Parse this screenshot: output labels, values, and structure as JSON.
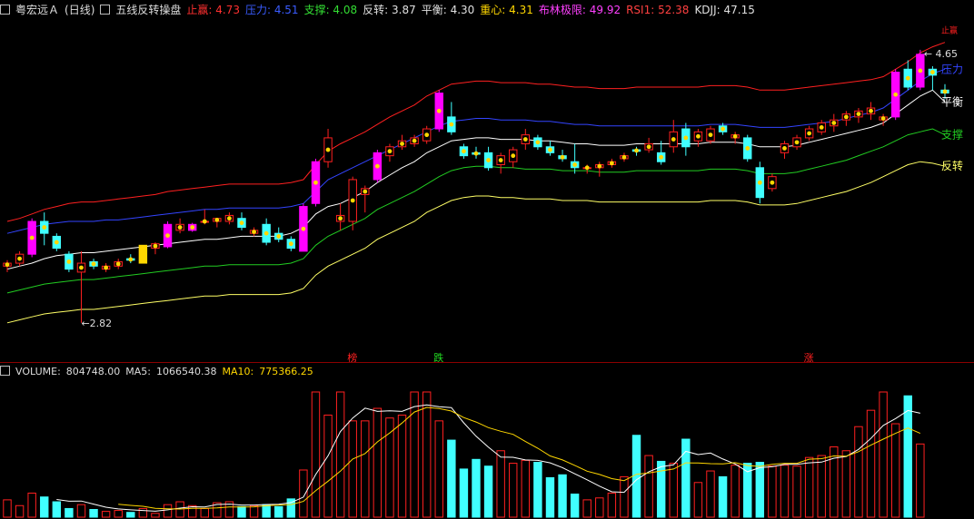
{
  "header": {
    "stock": "粤宏远Ａ",
    "period": "(日线)",
    "indicator": "五线反转操盘",
    "items": [
      {
        "label": "止赢:",
        "value": "4.73",
        "color": "#ff3030"
      },
      {
        "label": "压力:",
        "value": "4.51",
        "color": "#3a5cff"
      },
      {
        "label": "支撑:",
        "value": "4.08",
        "color": "#33dd33"
      },
      {
        "label": "反转:",
        "value": "3.87",
        "color": "#e0e0e0"
      },
      {
        "label": "平衡:",
        "value": "4.30",
        "color": "#e0e0e0"
      },
      {
        "label": "重心:",
        "value": "4.31",
        "color": "#ffd700"
      },
      {
        "label": "布林极限:",
        "value": "49.92",
        "color": "#ff40ff"
      },
      {
        "label": "RSI1:",
        "value": "52.38",
        "color": "#ff4040"
      },
      {
        "label": "KDJJ:",
        "value": "47.15",
        "color": "#e0e0e0"
      }
    ]
  },
  "volume_header": {
    "label": "VOLUME:",
    "value": "804748.00",
    "ma5_label": "MA5:",
    "ma5_value": "1066540.38",
    "ma10_label": "MA10:",
    "ma10_value": "775366.25"
  },
  "colors": {
    "up": "#ff2020",
    "down": "#40ffff",
    "magenta": "#ff00ff",
    "yellow": "#ffd700",
    "stop": "#ff2020",
    "press": "#3344ff",
    "support": "#22cc22",
    "reverse": "#ffff66",
    "balance": "#ffffff"
  },
  "chart_data": [
    {
      "type": "candlestick",
      "price_range": [
        2.6,
        4.85
      ],
      "annotations": {
        "high_label": "4.65",
        "low_label": "2.82",
        "markers": [
          "榜",
          "跌",
          "涨"
        ]
      },
      "line_labels": [
        "止赢",
        "压力",
        "平衡",
        "支撑",
        "反转"
      ],
      "candles": [
        {
          "o": 3.2,
          "h": 3.24,
          "l": 3.16,
          "c": 3.22
        },
        {
          "o": 3.22,
          "h": 3.3,
          "l": 3.2,
          "c": 3.28
        },
        {
          "o": 3.28,
          "h": 3.52,
          "l": 3.26,
          "c": 3.5,
          "m": 1
        },
        {
          "o": 3.5,
          "h": 3.56,
          "l": 3.34,
          "c": 3.42
        },
        {
          "o": 3.4,
          "h": 3.42,
          "l": 3.3,
          "c": 3.32
        },
        {
          "o": 3.28,
          "h": 3.3,
          "l": 3.16,
          "c": 3.18
        },
        {
          "o": 3.16,
          "h": 3.3,
          "l": 2.82,
          "c": 3.22
        },
        {
          "o": 3.23,
          "h": 3.25,
          "l": 3.18,
          "c": 3.2
        },
        {
          "o": 3.18,
          "h": 3.22,
          "l": 3.16,
          "c": 3.2
        },
        {
          "o": 3.2,
          "h": 3.25,
          "l": 3.18,
          "c": 3.23
        },
        {
          "o": 3.25,
          "h": 3.28,
          "l": 3.22,
          "c": 3.24
        },
        {
          "o": 3.22,
          "h": 3.34,
          "l": 3.22,
          "c": 3.34,
          "y": 1
        },
        {
          "o": 3.32,
          "h": 3.36,
          "l": 3.28,
          "c": 3.35
        },
        {
          "o": 3.33,
          "h": 3.5,
          "l": 3.32,
          "c": 3.48,
          "m": 1
        },
        {
          "o": 3.44,
          "h": 3.52,
          "l": 3.42,
          "c": 3.48
        },
        {
          "o": 3.44,
          "h": 3.49,
          "l": 3.43,
          "c": 3.48,
          "m": 1
        },
        {
          "o": 3.5,
          "h": 3.58,
          "l": 3.48,
          "c": 3.5
        },
        {
          "o": 3.5,
          "h": 3.52,
          "l": 3.46,
          "c": 3.52
        },
        {
          "o": 3.5,
          "h": 3.56,
          "l": 3.48,
          "c": 3.54
        },
        {
          "o": 3.52,
          "h": 3.56,
          "l": 3.44,
          "c": 3.46
        },
        {
          "o": 3.42,
          "h": 3.46,
          "l": 3.4,
          "c": 3.44
        },
        {
          "o": 3.48,
          "h": 3.52,
          "l": 3.34,
          "c": 3.36
        },
        {
          "o": 3.42,
          "h": 3.46,
          "l": 3.36,
          "c": 3.38
        },
        {
          "o": 3.38,
          "h": 3.4,
          "l": 3.3,
          "c": 3.32
        },
        {
          "o": 3.3,
          "h": 3.62,
          "l": 3.3,
          "c": 3.6,
          "m": 1
        },
        {
          "o": 3.62,
          "h": 3.92,
          "l": 3.6,
          "c": 3.9,
          "m": 1
        },
        {
          "o": 3.9,
          "h": 4.12,
          "l": 3.86,
          "c": 4.06
        },
        {
          "o": 3.5,
          "h": 3.62,
          "l": 3.44,
          "c": 3.54
        },
        {
          "o": 3.5,
          "h": 3.8,
          "l": 3.44,
          "c": 3.78
        },
        {
          "o": 3.68,
          "h": 3.74,
          "l": 3.56,
          "c": 3.72
        },
        {
          "o": 3.78,
          "h": 3.98,
          "l": 3.76,
          "c": 3.96,
          "m": 1
        },
        {
          "o": 3.94,
          "h": 4.02,
          "l": 3.9,
          "c": 4.0
        },
        {
          "o": 4.0,
          "h": 4.08,
          "l": 3.98,
          "c": 4.04
        },
        {
          "o": 4.02,
          "h": 4.08,
          "l": 4.0,
          "c": 4.06
        },
        {
          "o": 4.04,
          "h": 4.14,
          "l": 4.02,
          "c": 4.12
        },
        {
          "o": 4.12,
          "h": 4.38,
          "l": 4.1,
          "c": 4.36,
          "m": 1
        },
        {
          "o": 4.2,
          "h": 4.3,
          "l": 4.08,
          "c": 4.1
        },
        {
          "o": 4.0,
          "h": 4.02,
          "l": 3.92,
          "c": 3.94
        },
        {
          "o": 3.96,
          "h": 4.0,
          "l": 3.92,
          "c": 3.95
        },
        {
          "o": 3.96,
          "h": 4.0,
          "l": 3.84,
          "c": 3.86
        },
        {
          "o": 3.88,
          "h": 3.96,
          "l": 3.82,
          "c": 3.94
        },
        {
          "o": 3.9,
          "h": 4.0,
          "l": 3.86,
          "c": 3.98
        },
        {
          "o": 4.02,
          "h": 4.12,
          "l": 3.98,
          "c": 4.08
        },
        {
          "o": 4.06,
          "h": 4.08,
          "l": 3.98,
          "c": 4.0
        },
        {
          "o": 4.0,
          "h": 4.04,
          "l": 3.94,
          "c": 3.96
        },
        {
          "o": 3.94,
          "h": 3.98,
          "l": 3.9,
          "c": 3.92
        },
        {
          "o": 3.9,
          "h": 4.02,
          "l": 3.82,
          "c": 3.86
        },
        {
          "o": 3.86,
          "h": 3.88,
          "l": 3.82,
          "c": 3.86
        },
        {
          "o": 3.86,
          "h": 3.9,
          "l": 3.8,
          "c": 3.88
        },
        {
          "o": 3.88,
          "h": 3.92,
          "l": 3.86,
          "c": 3.9
        },
        {
          "o": 3.92,
          "h": 3.96,
          "l": 3.9,
          "c": 3.94
        },
        {
          "o": 3.98,
          "h": 4.0,
          "l": 3.94,
          "c": 3.97
        },
        {
          "o": 3.98,
          "h": 4.06,
          "l": 3.96,
          "c": 4.02
        },
        {
          "o": 3.96,
          "h": 4.04,
          "l": 3.88,
          "c": 3.9
        },
        {
          "o": 4.0,
          "h": 4.18,
          "l": 3.96,
          "c": 4.1
        },
        {
          "o": 4.12,
          "h": 4.16,
          "l": 3.94,
          "c": 4.0
        },
        {
          "o": 4.04,
          "h": 4.12,
          "l": 4.0,
          "c": 4.1
        },
        {
          "o": 4.04,
          "h": 4.14,
          "l": 4.02,
          "c": 4.12
        },
        {
          "o": 4.14,
          "h": 4.16,
          "l": 4.08,
          "c": 4.1
        },
        {
          "o": 4.06,
          "h": 4.1,
          "l": 4.02,
          "c": 4.08
        },
        {
          "o": 4.06,
          "h": 4.08,
          "l": 3.9,
          "c": 3.92
        },
        {
          "o": 3.86,
          "h": 3.9,
          "l": 3.62,
          "c": 3.66
        },
        {
          "o": 3.72,
          "h": 3.82,
          "l": 3.7,
          "c": 3.8
        },
        {
          "o": 3.96,
          "h": 4.04,
          "l": 3.92,
          "c": 4.02
        },
        {
          "o": 4.0,
          "h": 4.08,
          "l": 3.98,
          "c": 4.06
        },
        {
          "o": 4.06,
          "h": 4.14,
          "l": 4.04,
          "c": 4.12
        },
        {
          "o": 4.1,
          "h": 4.18,
          "l": 4.08,
          "c": 4.16
        },
        {
          "o": 4.14,
          "h": 4.22,
          "l": 4.1,
          "c": 4.18
        },
        {
          "o": 4.18,
          "h": 4.24,
          "l": 4.14,
          "c": 4.22
        },
        {
          "o": 4.2,
          "h": 4.26,
          "l": 4.16,
          "c": 4.24
        },
        {
          "o": 4.22,
          "h": 4.3,
          "l": 4.18,
          "c": 4.26
        },
        {
          "o": 4.18,
          "h": 4.22,
          "l": 4.14,
          "c": 4.2
        },
        {
          "o": 4.2,
          "h": 4.52,
          "l": 4.18,
          "c": 4.5,
          "m": 1
        },
        {
          "o": 4.52,
          "h": 4.58,
          "l": 4.38,
          "c": 4.4
        },
        {
          "o": 4.4,
          "h": 4.65,
          "l": 4.38,
          "c": 4.62,
          "m": 1
        },
        {
          "o": 4.52,
          "h": 4.54,
          "l": 4.38,
          "c": 4.48
        },
        {
          "o": 4.38,
          "h": 4.42,
          "l": 4.32,
          "c": 4.36
        }
      ],
      "stop_line": [
        3.5,
        3.52,
        3.55,
        3.58,
        3.6,
        3.62,
        3.63,
        3.63,
        3.64,
        3.65,
        3.66,
        3.67,
        3.68,
        3.7,
        3.71,
        3.72,
        3.73,
        3.74,
        3.75,
        3.75,
        3.75,
        3.75,
        3.75,
        3.76,
        3.78,
        3.88,
        3.97,
        4.02,
        4.06,
        4.1,
        4.15,
        4.2,
        4.24,
        4.28,
        4.34,
        4.38,
        4.42,
        4.43,
        4.44,
        4.44,
        4.43,
        4.43,
        4.43,
        4.42,
        4.42,
        4.41,
        4.4,
        4.4,
        4.39,
        4.39,
        4.39,
        4.4,
        4.4,
        4.4,
        4.4,
        4.4,
        4.4,
        4.41,
        4.41,
        4.41,
        4.4,
        4.38,
        4.38,
        4.38,
        4.39,
        4.4,
        4.41,
        4.42,
        4.43,
        4.44,
        4.45,
        4.47,
        4.52,
        4.57,
        4.63,
        4.67,
        4.7
      ],
      "press_line": [
        3.42,
        3.44,
        3.46,
        3.48,
        3.49,
        3.5,
        3.5,
        3.5,
        3.51,
        3.51,
        3.52,
        3.53,
        3.54,
        3.55,
        3.56,
        3.57,
        3.58,
        3.58,
        3.59,
        3.59,
        3.59,
        3.59,
        3.59,
        3.6,
        3.62,
        3.7,
        3.78,
        3.82,
        3.86,
        3.9,
        3.94,
        3.98,
        4.02,
        4.06,
        4.1,
        4.14,
        4.17,
        4.18,
        4.19,
        4.19,
        4.18,
        4.18,
        4.18,
        4.17,
        4.17,
        4.16,
        4.15,
        4.15,
        4.14,
        4.14,
        4.14,
        4.14,
        4.14,
        4.14,
        4.14,
        4.14,
        4.14,
        4.15,
        4.15,
        4.15,
        4.14,
        4.13,
        4.13,
        4.13,
        4.14,
        4.15,
        4.16,
        4.17,
        4.19,
        4.21,
        4.23,
        4.26,
        4.32,
        4.38,
        4.44,
        4.49,
        4.52
      ],
      "balance_line": [
        3.18,
        3.2,
        3.22,
        3.25,
        3.27,
        3.28,
        3.29,
        3.29,
        3.3,
        3.31,
        3.32,
        3.33,
        3.34,
        3.35,
        3.36,
        3.37,
        3.38,
        3.38,
        3.39,
        3.4,
        3.4,
        3.4,
        3.4,
        3.42,
        3.46,
        3.55,
        3.6,
        3.62,
        3.66,
        3.7,
        3.76,
        3.81,
        3.86,
        3.9,
        3.96,
        4.0,
        4.04,
        4.05,
        4.06,
        4.06,
        4.05,
        4.05,
        4.05,
        4.04,
        4.04,
        4.03,
        4.02,
        4.02,
        4.01,
        4.01,
        4.01,
        4.02,
        4.02,
        4.02,
        4.02,
        4.02,
        4.02,
        4.03,
        4.03,
        4.03,
        4.02,
        4.0,
        4.0,
        4.0,
        4.01,
        4.03,
        4.05,
        4.07,
        4.09,
        4.11,
        4.13,
        4.16,
        4.22,
        4.28,
        4.34,
        4.38,
        4.3
      ],
      "support_line": [
        3.02,
        3.04,
        3.06,
        3.08,
        3.09,
        3.1,
        3.11,
        3.11,
        3.12,
        3.13,
        3.14,
        3.15,
        3.16,
        3.17,
        3.18,
        3.19,
        3.2,
        3.2,
        3.21,
        3.21,
        3.21,
        3.21,
        3.21,
        3.22,
        3.25,
        3.34,
        3.4,
        3.44,
        3.48,
        3.52,
        3.58,
        3.62,
        3.66,
        3.7,
        3.75,
        3.8,
        3.84,
        3.86,
        3.87,
        3.87,
        3.86,
        3.86,
        3.85,
        3.85,
        3.85,
        3.84,
        3.84,
        3.84,
        3.83,
        3.83,
        3.83,
        3.84,
        3.84,
        3.84,
        3.84,
        3.84,
        3.84,
        3.85,
        3.85,
        3.85,
        3.84,
        3.82,
        3.82,
        3.82,
        3.83,
        3.85,
        3.87,
        3.89,
        3.91,
        3.94,
        3.97,
        4.0,
        4.04,
        4.08,
        4.1,
        4.12,
        4.08
      ],
      "reverse_line": [
        2.82,
        2.84,
        2.86,
        2.88,
        2.89,
        2.9,
        2.91,
        2.91,
        2.92,
        2.93,
        2.94,
        2.95,
        2.96,
        2.97,
        2.98,
        2.99,
        3.0,
        3.0,
        3.01,
        3.01,
        3.01,
        3.01,
        3.01,
        3.02,
        3.05,
        3.14,
        3.2,
        3.24,
        3.28,
        3.32,
        3.38,
        3.42,
        3.46,
        3.5,
        3.56,
        3.6,
        3.64,
        3.66,
        3.67,
        3.67,
        3.66,
        3.66,
        3.65,
        3.65,
        3.65,
        3.64,
        3.64,
        3.64,
        3.63,
        3.63,
        3.63,
        3.63,
        3.63,
        3.63,
        3.63,
        3.63,
        3.63,
        3.64,
        3.64,
        3.64,
        3.63,
        3.61,
        3.61,
        3.61,
        3.62,
        3.64,
        3.66,
        3.68,
        3.7,
        3.73,
        3.76,
        3.8,
        3.84,
        3.88,
        3.9,
        3.89,
        3.87
      ]
    },
    {
      "type": "bar",
      "series_name": "VOLUME",
      "values": [
        180,
        120,
        250,
        210,
        160,
        90,
        130,
        80,
        60,
        70,
        50,
        90,
        40,
        130,
        160,
        120,
        90,
        150,
        160,
        110,
        120,
        130,
        110,
        190,
        490,
        1300,
        1060,
        1300,
        1000,
        1000,
        1130,
        1030,
        1060,
        1300,
        1300,
        1000,
        800,
        500,
        600,
        530,
        690,
        560,
        590,
        570,
        410,
        440,
        240,
        180,
        200,
        250,
        420,
        850,
        640,
        580,
        560,
        810,
        360,
        480,
        420,
        540,
        560,
        570,
        530,
        540,
        530,
        620,
        640,
        730,
        690,
        940,
        1110,
        1300,
        970,
        1260,
        760
      ],
      "ma5": [
        0,
        0,
        0,
        0,
        184,
        166,
        168,
        136,
        104,
        86,
        76,
        70,
        62,
        76,
        94,
        108,
        106,
        132,
        136,
        126,
        126,
        132,
        134,
        152,
        208,
        444,
        638,
        888,
        1030,
        1132,
        1098,
        1104,
        1098,
        1148,
        1166,
        1146,
        1138,
        980,
        840,
        726,
        624,
        622,
        594,
        590,
        564,
        514,
        450,
        388,
        322,
        264,
        258,
        388,
        472,
        524,
        544,
        684,
        650,
        666,
        604,
        552,
        472,
        514,
        524,
        548,
        548,
        564,
        572,
        612,
        630,
        704,
        818,
        952,
        1024,
        1108,
        1080
      ],
      "ma10": [
        0,
        0,
        0,
        0,
        0,
        0,
        0,
        0,
        0,
        135,
        122,
        113,
        92,
        88,
        85,
        91,
        91,
        97,
        106,
        106,
        107,
        119,
        126,
        131,
        164,
        276,
        374,
        478,
        604,
        660,
        782,
        874,
        978,
        1092,
        1140,
        1128,
        1102,
        1034,
        988,
        930,
        892,
        860,
        786,
        716,
        636,
        594,
        538,
        478,
        444,
        400,
        380,
        446,
        460,
        480,
        500,
        564,
        562,
        556,
        554,
        566,
        536,
        528,
        548,
        560,
        560,
        602,
        608,
        636,
        634,
        680,
        748,
        810,
        870,
        926,
        870
      ]
    }
  ]
}
